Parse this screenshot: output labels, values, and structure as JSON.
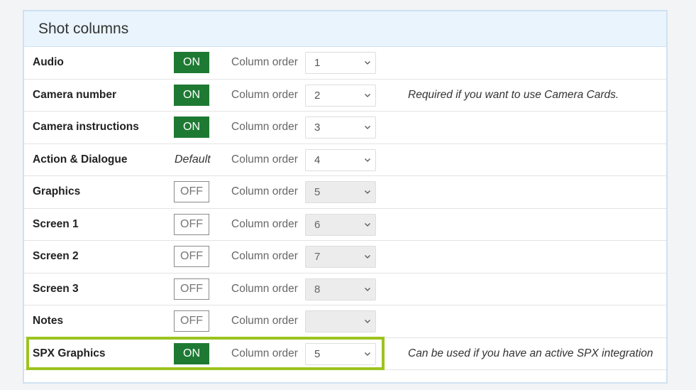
{
  "panel": {
    "title": "Shot columns"
  },
  "column_order_label": "Column order",
  "rows": [
    {
      "name": "Audio",
      "state": "ON",
      "order": "1",
      "enabled": true,
      "note": ""
    },
    {
      "name": "Camera number",
      "state": "ON",
      "order": "2",
      "enabled": true,
      "note": "Required if you want to use Camera Cards."
    },
    {
      "name": "Camera instructions",
      "state": "ON",
      "order": "3",
      "enabled": true,
      "note": ""
    },
    {
      "name": "Action & Dialogue",
      "state": "Default",
      "order": "4",
      "enabled": true,
      "note": ""
    },
    {
      "name": "Graphics",
      "state": "OFF",
      "order": "5",
      "enabled": false,
      "note": ""
    },
    {
      "name": "Screen 1",
      "state": "OFF",
      "order": "6",
      "enabled": false,
      "note": ""
    },
    {
      "name": "Screen 2",
      "state": "OFF",
      "order": "7",
      "enabled": false,
      "note": ""
    },
    {
      "name": "Screen 3",
      "state": "OFF",
      "order": "8",
      "enabled": false,
      "note": ""
    },
    {
      "name": "Notes",
      "state": "OFF",
      "order": "",
      "enabled": false,
      "note": ""
    },
    {
      "name": "SPX Graphics",
      "state": "ON",
      "order": "5",
      "enabled": true,
      "note": "Can be used if you have an active SPX integration",
      "highlighted": true
    }
  ],
  "colors": {
    "toggle_on": "#1e7a33",
    "highlight": "#9cc31f",
    "header_bg": "#eaf4fd"
  },
  "icons": {
    "select_arrow": "chevron-down-icon"
  }
}
